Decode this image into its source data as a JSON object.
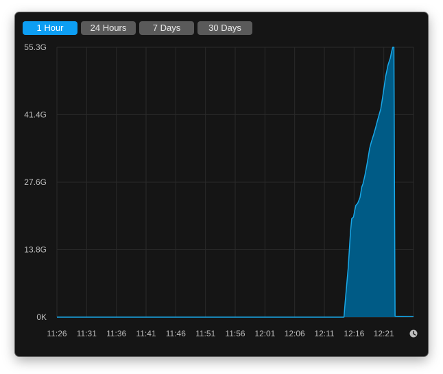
{
  "time_ranges": {
    "selected": "1 Hour",
    "options": [
      {
        "label": "1 Hour",
        "active": true
      },
      {
        "label": "24 Hours",
        "active": false
      },
      {
        "label": "7 Days",
        "active": false
      },
      {
        "label": "30 Days",
        "active": false
      }
    ]
  },
  "clock_icon": "clock-icon",
  "colors": {
    "window_background": "#151515",
    "active_tab": "#0d9ef3",
    "inactive_tab": "#5a5a5a",
    "area_fill": "#005b86",
    "line": "#19a8e8",
    "grid": "#2a2a2a",
    "tick_text": "#bdbdbd"
  },
  "chart_data": {
    "type": "area",
    "title": "",
    "xlabel": "",
    "ylabel": "",
    "x_tick_labels": [
      "11:26",
      "11:31",
      "11:36",
      "11:41",
      "11:46",
      "11:51",
      "11:56",
      "12:01",
      "12:06",
      "12:11",
      "12:16",
      "12:21"
    ],
    "y_tick_labels": [
      "0K",
      "13.8G",
      "27.6G",
      "41.4G",
      "55.3G"
    ],
    "ylim": [
      0,
      55.3
    ],
    "x_unit": "minutes past 11:26",
    "y_unit": "G",
    "grid": true,
    "legend": "none",
    "series": [
      {
        "points": [
          [
            0,
            0
          ],
          [
            48.3,
            0
          ],
          [
            48.5,
            3
          ],
          [
            49,
            10
          ],
          [
            49.4,
            17.5
          ],
          [
            49.6,
            20.2
          ],
          [
            49.9,
            20.5
          ],
          [
            50.1,
            21.8
          ],
          [
            50.3,
            22.9
          ],
          [
            50.6,
            23.3
          ],
          [
            51,
            24.5
          ],
          [
            51.3,
            26.7
          ],
          [
            51.5,
            27.3
          ],
          [
            51.8,
            28.9
          ],
          [
            52.1,
            30.8
          ],
          [
            52.4,
            32.9
          ],
          [
            52.6,
            34.5
          ],
          [
            52.9,
            35.9
          ],
          [
            53.3,
            37.4
          ],
          [
            53.6,
            38.7
          ],
          [
            53.9,
            40.1
          ],
          [
            54.2,
            41.4
          ],
          [
            54.5,
            42.7
          ],
          [
            54.8,
            45
          ],
          [
            55.1,
            47.5
          ],
          [
            55.3,
            49.3
          ],
          [
            55.5,
            50.4
          ],
          [
            55.7,
            51.6
          ],
          [
            55.9,
            52.4
          ],
          [
            56.1,
            53.1
          ],
          [
            56.3,
            54.3
          ],
          [
            56.5,
            55.3
          ],
          [
            56.7,
            55.3
          ],
          [
            56.9,
            0.2
          ],
          [
            60,
            0.1
          ]
        ]
      }
    ]
  }
}
